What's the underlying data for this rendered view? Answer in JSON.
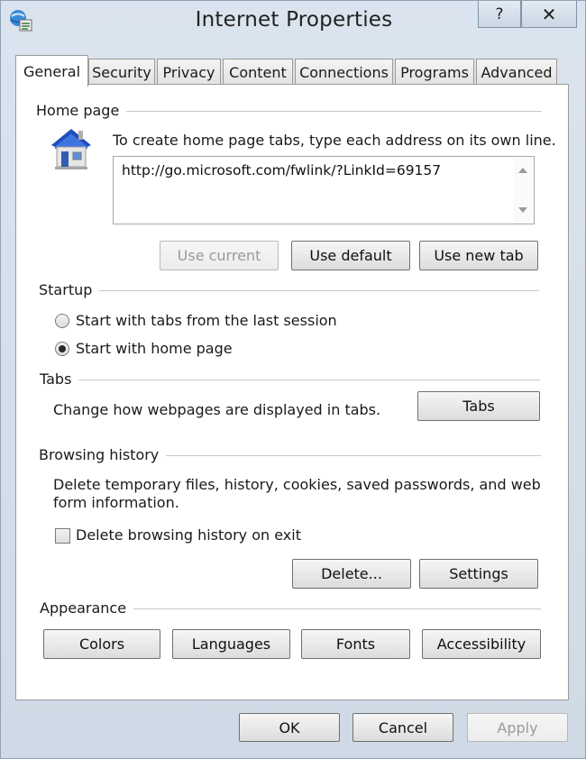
{
  "window": {
    "title": "Internet Properties",
    "help_label": "?",
    "close_label": "✕"
  },
  "tabs": [
    {
      "label": "General",
      "active": true
    },
    {
      "label": "Security"
    },
    {
      "label": "Privacy"
    },
    {
      "label": "Content"
    },
    {
      "label": "Connections"
    },
    {
      "label": "Programs"
    },
    {
      "label": "Advanced"
    }
  ],
  "home_page": {
    "section_title": "Home page",
    "icon": "house-icon",
    "instruction": "To create home page tabs, type each address on its own line.",
    "url_value": "http://go.microsoft.com/fwlink/?LinkId=69157",
    "use_current_label": "Use current",
    "use_default_label": "Use default",
    "use_new_tab_label": "Use new tab"
  },
  "startup": {
    "section_title": "Startup",
    "options": [
      {
        "label": "Start with tabs from the last session",
        "checked": false
      },
      {
        "label": "Start with home page",
        "checked": true
      }
    ]
  },
  "tabs_section": {
    "section_title": "Tabs",
    "description": "Change how webpages are displayed in tabs.",
    "button_label": "Tabs"
  },
  "browsing_history": {
    "section_title": "Browsing history",
    "description_line1": "Delete temporary files, history, cookies, saved passwords, and web",
    "description_line2": "form information.",
    "delete_on_exit_label": "Delete browsing history on exit",
    "delete_on_exit_checked": false,
    "delete_label": "Delete...",
    "settings_label": "Settings"
  },
  "appearance": {
    "section_title": "Appearance",
    "colors_label": "Colors",
    "languages_label": "Languages",
    "fonts_label": "Fonts",
    "accessibility_label": "Accessibility"
  },
  "footer": {
    "ok_label": "OK",
    "cancel_label": "Cancel",
    "apply_label": "Apply"
  },
  "colors": {
    "window_frame": "#cfdae6",
    "house_roof": "#1f4fbf"
  }
}
